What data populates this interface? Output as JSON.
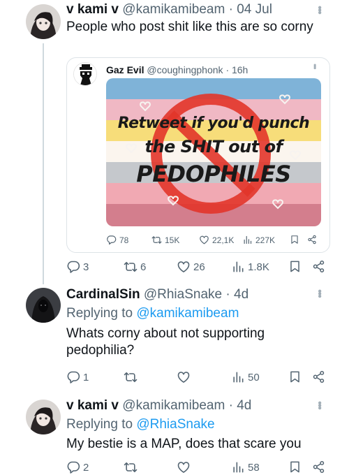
{
  "tweet1": {
    "name": "v kami v",
    "handle": "@kamikamibeam",
    "time": "· 04 Jul",
    "text": "People who post shit like this are so corny",
    "stats": {
      "replies": "3",
      "retweets": "6",
      "likes": "26",
      "views": "1.8K"
    }
  },
  "quote": {
    "name": "Gaz Evil",
    "handle": "@coughingphonk",
    "time": "· 16h",
    "image_text": {
      "line1": "Retweet if you'd punch",
      "line2": "the SHIT out of",
      "line3": "PEDOPHILES"
    },
    "stats": {
      "replies": "78",
      "retweets": "15K",
      "likes": "22,1K",
      "views": "227K"
    }
  },
  "tweet2": {
    "name": "CardinalSin",
    "handle": "@RhiaSnake",
    "time": "· 4d",
    "replying_prefix": "Replying to ",
    "replying_to": "@kamikamibeam",
    "text": "Whats corny about not supporting pedophilia?",
    "stats": {
      "replies": "1",
      "retweets": "",
      "likes": "",
      "views": "50"
    }
  },
  "tweet3": {
    "name": "v kami v",
    "handle": "@kamikamibeam",
    "time": "· 4d",
    "replying_prefix": "Replying to ",
    "replying_to": "@RhiaSnake",
    "text": "My bestie is a MAP, does that scare you",
    "stats": {
      "replies": "2",
      "retweets": "",
      "likes": "",
      "views": "58"
    }
  },
  "colors": {
    "text": "#0f1419",
    "secondary": "#536471",
    "link": "#1d9bf0",
    "border": "#cfd9de"
  },
  "icons": [
    "reply-icon",
    "retweet-icon",
    "like-icon",
    "views-icon",
    "bookmark-icon",
    "share-icon",
    "more-icon"
  ]
}
